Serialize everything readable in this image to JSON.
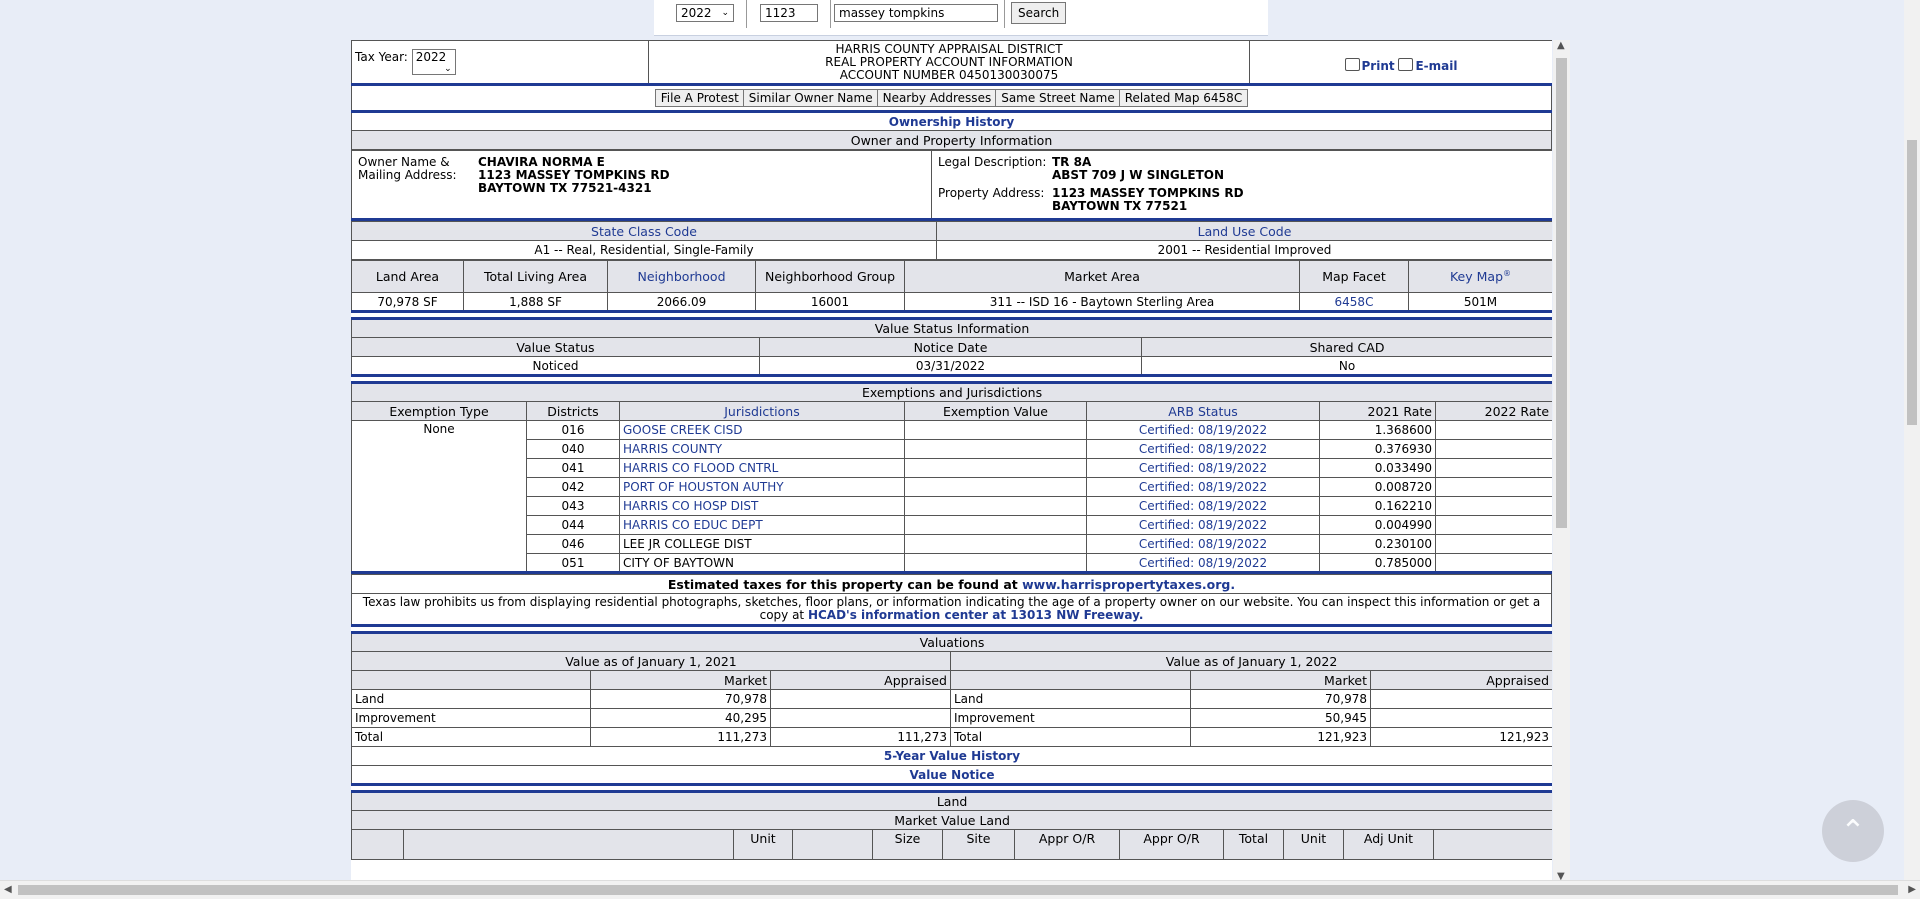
{
  "search": {
    "year": "2022",
    "street_number": "1123",
    "street_name": "massey tompkins",
    "search_label": "Search"
  },
  "header": {
    "tax_year_label": "Tax Year:",
    "tax_year": "2022",
    "line1": "HARRIS COUNTY APPRAISAL DISTRICT",
    "line2": "REAL PROPERTY ACCOUNT INFORMATION",
    "line3": "ACCOUNT NUMBER 0450130030075",
    "print_label": "Print",
    "email_label": "E-mail"
  },
  "nav": [
    "File A Protest",
    "Similar Owner Name",
    "Nearby Addresses",
    "Same Street Name",
    "Related Map 6458C"
  ],
  "ownership_history": "Ownership History",
  "owner_section": {
    "title": "Owner and Property Information",
    "owner_label": "Owner Name &\nMailing Address:",
    "owner_name": "CHAVIRA NORMA E",
    "mail_line1": "1123 MASSEY TOMPKINS RD",
    "mail_line2": "BAYTOWN TX 77521-4321",
    "legal_label": "Legal Description:",
    "legal_line1": "TR 8A",
    "legal_line2": "ABST 709 J W SINGLETON",
    "prop_label": "Property Address:",
    "prop_line1": "1123 MASSEY TOMPKINS RD",
    "prop_line2": "BAYTOWN TX 77521"
  },
  "class_codes": {
    "state_class_label": "State Class Code",
    "land_use_label": "Land Use Code",
    "state_class_value": "A1 -- Real, Residential, Single-Family",
    "land_use_value": "2001 -- Residential Improved"
  },
  "area_table": {
    "headers": [
      "Land Area",
      "Total Living Area",
      "Neighborhood",
      "Neighborhood Group",
      "Market Area",
      "Map Facet",
      "Key Map"
    ],
    "key_map_mark": "®",
    "values": [
      "70,978 SF",
      "1,888 SF",
      "2066.09",
      "16001",
      "311 -- ISD 16 - Baytown Sterling Area",
      "6458C",
      "501M"
    ]
  },
  "value_status": {
    "title": "Value Status Information",
    "headers": [
      "Value Status",
      "Notice Date",
      "Shared CAD"
    ],
    "values": [
      "Noticed",
      "03/31/2022",
      "No"
    ]
  },
  "exemptions": {
    "title": "Exemptions and Jurisdictions",
    "headers": [
      "Exemption Type",
      "Districts",
      "Jurisdictions",
      "Exemption Value",
      "ARB Status",
      "2021 Rate",
      "2022 Rate"
    ],
    "exemption_type": "None",
    "rows": [
      {
        "district": "016",
        "name": "GOOSE CREEK CISD",
        "link": true,
        "arb": "Certified: 08/19/2022",
        "rate2021": "1.368600"
      },
      {
        "district": "040",
        "name": "HARRIS COUNTY",
        "link": true,
        "arb": "Certified: 08/19/2022",
        "rate2021": "0.376930"
      },
      {
        "district": "041",
        "name": "HARRIS CO FLOOD CNTRL",
        "link": true,
        "arb": "Certified: 08/19/2022",
        "rate2021": "0.033490"
      },
      {
        "district": "042",
        "name": "PORT OF HOUSTON AUTHY",
        "link": true,
        "arb": "Certified: 08/19/2022",
        "rate2021": "0.008720"
      },
      {
        "district": "043",
        "name": "HARRIS CO HOSP DIST",
        "link": true,
        "arb": "Certified: 08/19/2022",
        "rate2021": "0.162210"
      },
      {
        "district": "044",
        "name": "HARRIS CO EDUC DEPT",
        "link": true,
        "arb": "Certified: 08/19/2022",
        "rate2021": "0.004990"
      },
      {
        "district": "046",
        "name": "LEE JR COLLEGE DIST",
        "link": false,
        "arb": "Certified: 08/19/2022",
        "rate2021": "0.230100"
      },
      {
        "district": "051",
        "name": "CITY OF BAYTOWN",
        "link": false,
        "arb": "Certified: 08/19/2022",
        "rate2021": "0.785000"
      }
    ]
  },
  "taxes_note": {
    "text": "Estimated taxes for this property can be found at ",
    "link": "www.harrispropertytaxes.org."
  },
  "law_note": {
    "text": "Texas law prohibits us from displaying residential photographs, sketches, floor plans, or information indicating the age of a property owner on our website. You can inspect this information or get a copy at ",
    "link": "HCAD's information center at 13013 NW Freeway."
  },
  "valuations": {
    "title": "Valuations",
    "left_title": "Value as of January 1, 2021",
    "right_title": "Value as of January 1, 2022",
    "market": "Market",
    "appraised": "Appraised",
    "rows_left": [
      {
        "label": "Land",
        "market": "70,978",
        "appraised": ""
      },
      {
        "label": "Improvement",
        "market": "40,295",
        "appraised": ""
      },
      {
        "label": "Total",
        "market": "111,273",
        "appraised": "111,273"
      }
    ],
    "rows_right": [
      {
        "label": "Land",
        "market": "70,978",
        "appraised": ""
      },
      {
        "label": "Improvement",
        "market": "50,945",
        "appraised": ""
      },
      {
        "label": "Total",
        "market": "121,923",
        "appraised": "121,923"
      }
    ]
  },
  "history_link": "5-Year Value History",
  "notice_link": "Value Notice",
  "land": {
    "title": "Land",
    "sub_title": "Market Value Land",
    "col_headers": [
      "Unit",
      "Size",
      "Site",
      "Appr O/R",
      "Appr O/R",
      "Total",
      "Unit",
      "Adj Unit"
    ]
  },
  "colors": {
    "link": "#1f3a93",
    "section_bg": "#e3e4ea",
    "page_bg": "#e8edf7"
  }
}
